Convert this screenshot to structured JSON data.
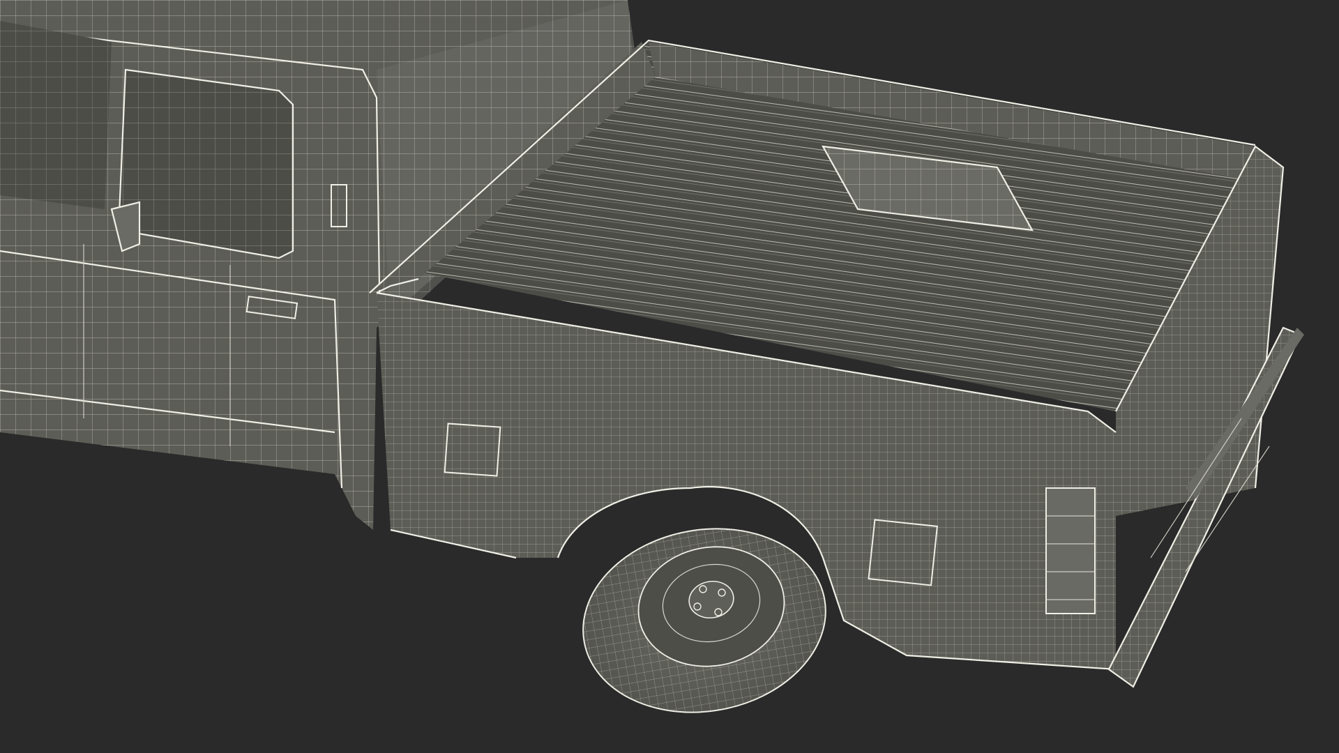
{
  "scene": {
    "subject": "pickup-truck-wireframe",
    "colors": {
      "background": "#2a2a2a",
      "body": "#5d5d57",
      "wire": "#d9d9cf"
    }
  }
}
